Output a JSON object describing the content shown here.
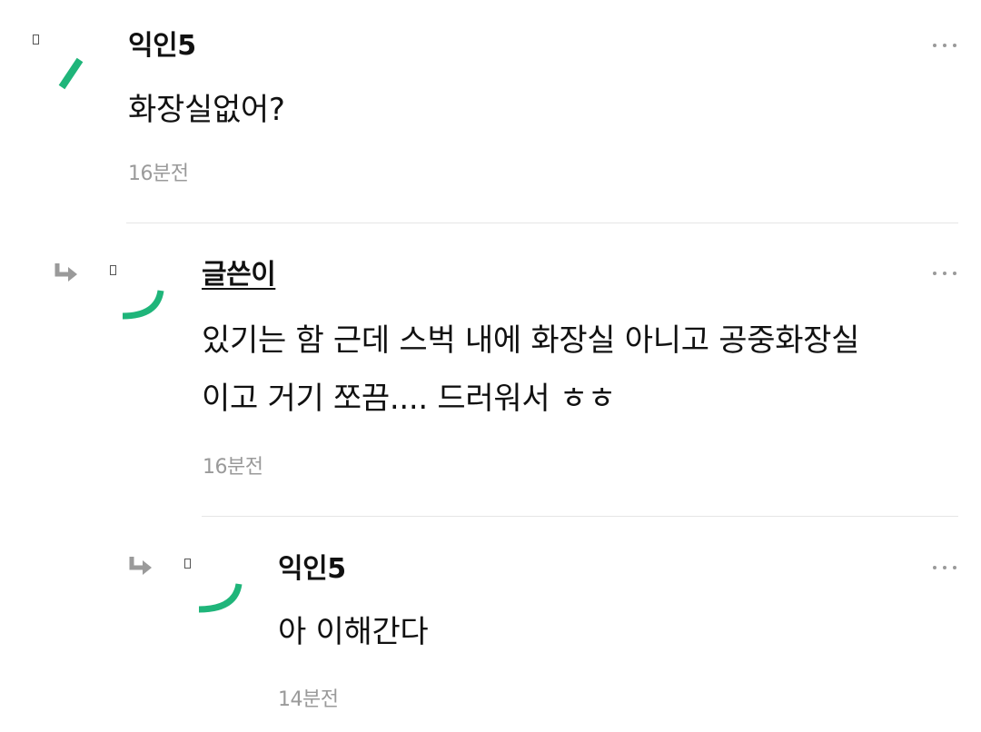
{
  "comments": [
    {
      "author": "익인5",
      "lines": [
        "화장실없어?"
      ],
      "time": "16분전",
      "accent_color": "#1fb57a"
    },
    {
      "author": "글쓴이",
      "lines": [
        "있기는 함 근데 스벅 내에 화장실 아니고 공중화장실",
        "이고 거기 쪼끔.... 드러워서 ㅎㅎ"
      ],
      "time": "16분전",
      "accent_color": "#1fb57a",
      "is_reply": true
    },
    {
      "author": "익인5",
      "lines": [
        "아 이해간다"
      ],
      "time": "14분전",
      "accent_color": "#1fb57a",
      "is_reply": true
    }
  ],
  "icons": {
    "reply": "reply-arrow-icon",
    "more": "more-dots-icon",
    "avatar": "avatar-icon"
  }
}
